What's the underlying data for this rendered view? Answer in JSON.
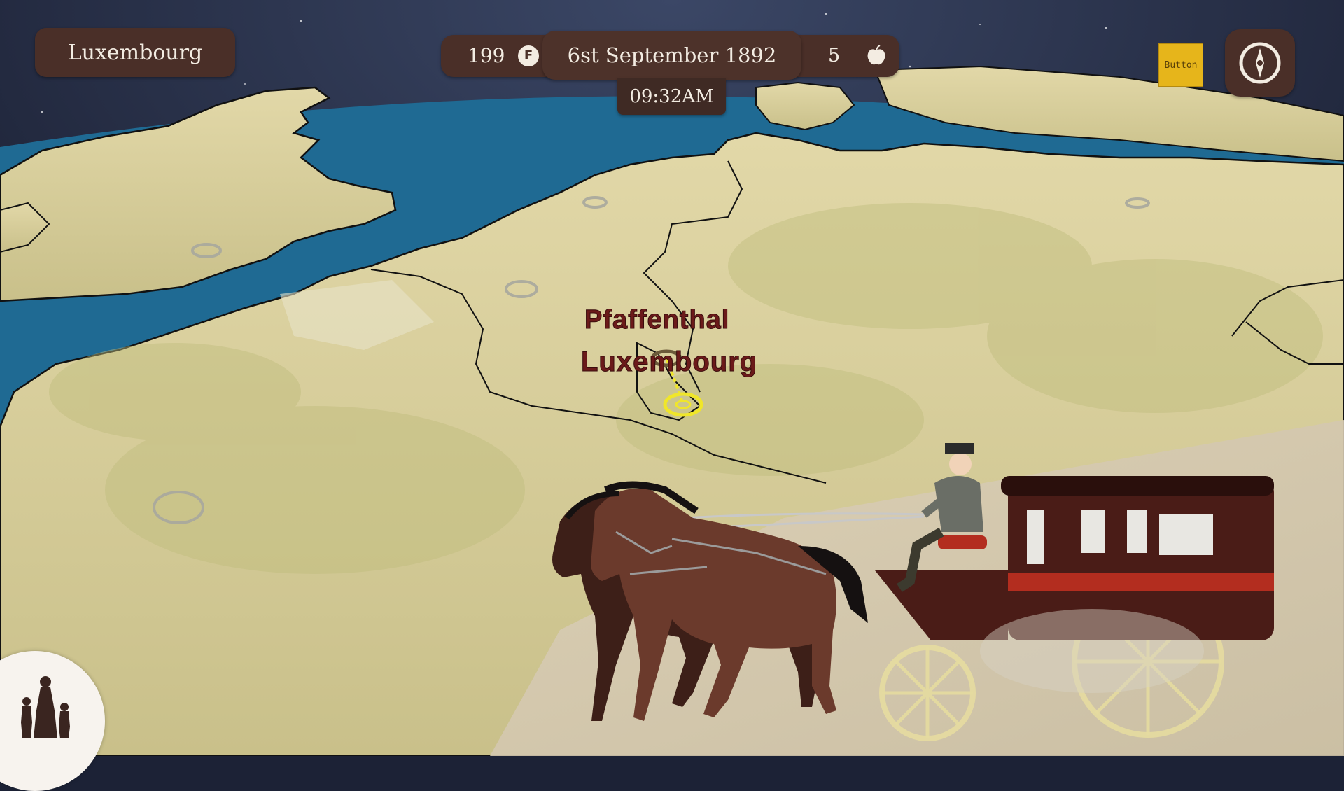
{
  "header": {
    "location_name": "Luxembourg",
    "money": "199",
    "money_icon": "franc-coin-icon",
    "money_icon_glyph": "F",
    "date": "6st September 1892",
    "food": "5",
    "food_icon": "apple-icon",
    "time": "09:32AM"
  },
  "controls": {
    "debug_button_label": "Button",
    "compass_icon": "compass-icon",
    "family_icon": "family-icon"
  },
  "map": {
    "labels": [
      "Pfaffenthal",
      "Luxembourg"
    ],
    "ocean_color": "#1f6a93",
    "land_color": "#d6cd9a",
    "space_color": "#1c2236"
  },
  "colors": {
    "panel": "#4a2f28",
    "panel_text": "#f3ece2",
    "debug_button": "#e6b51b",
    "current_location_marker": "#f0e62a",
    "label_text": "#6b1a1a"
  }
}
